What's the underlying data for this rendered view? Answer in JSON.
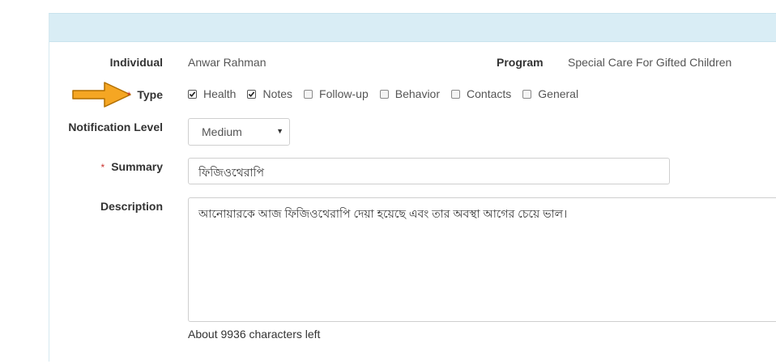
{
  "form": {
    "individual_label": "Individual",
    "individual_value": "Anwar Rahman",
    "program_label": "Program",
    "program_value": "Special Care For Gifted Children",
    "type_label": "Type",
    "required_mark": "*",
    "type_options": [
      {
        "label": "Health",
        "checked": true
      },
      {
        "label": "Notes",
        "checked": true
      },
      {
        "label": "Follow-up",
        "checked": false
      },
      {
        "label": "Behavior",
        "checked": false
      },
      {
        "label": "Contacts",
        "checked": false
      },
      {
        "label": "General",
        "checked": false
      }
    ],
    "notification_label": "Notification Level",
    "notification_value": "Medium",
    "summary_label": "Summary",
    "summary_value": "ফিজিওথেরাপি",
    "description_label": "Description",
    "description_value": "আনোয়ারকে আজ ফিজিওথেরাপি দেয়া হয়েছে এবং তার অবস্থা আগের চেয়ে ভাল।",
    "chars_left": "About 9936 characters left"
  },
  "annotation": {
    "arrow_color": "#f5a623",
    "arrow_stroke": "#b26f00"
  }
}
